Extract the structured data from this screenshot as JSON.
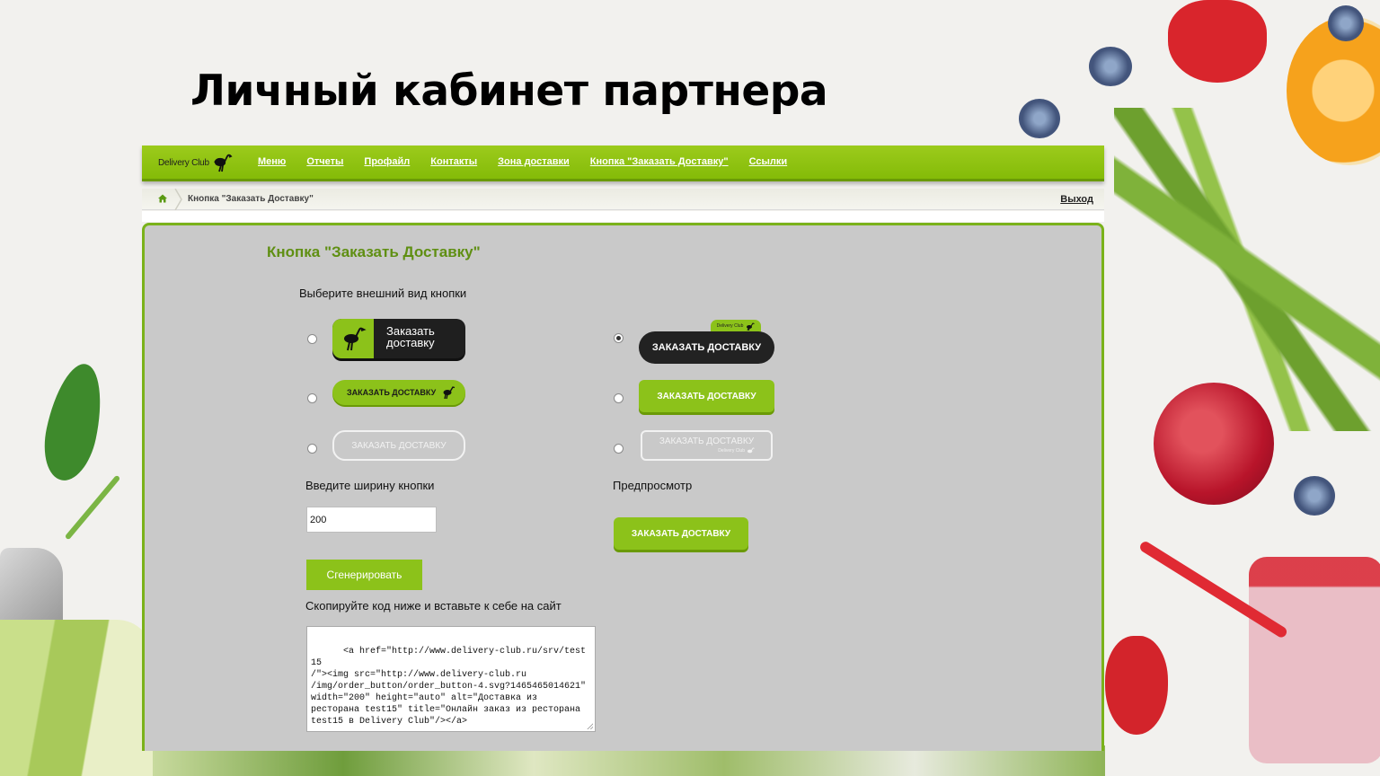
{
  "slide": {
    "title": "Личный кабинет партнера"
  },
  "topbar": {
    "logo_text": "Delivery Club",
    "nav": [
      "Меню",
      "Отчеты",
      "Профайл",
      "Контакты",
      "Зона доставки",
      "Кнопка \"Заказать Доставку\"",
      "Ссылки"
    ]
  },
  "breadcrumb": {
    "current": "Кнопка \"Заказать Доставку\"",
    "logout": "Выход"
  },
  "panel": {
    "title": "Кнопка \"Заказать Доставку\"",
    "choose_label": "Выберите внешний вид кнопки",
    "options": [
      {
        "text_line1": "Заказать",
        "text_line2": "доставку",
        "selected": false
      },
      {
        "text": "ЗАКАЗАТЬ ДОСТАВКУ",
        "selected": false
      },
      {
        "text": "ЗАКАЗАТЬ ДОСТАВКУ",
        "selected": false
      },
      {
        "badge": "Delivery Club",
        "text": "ЗАКАЗАТЬ ДОСТАВКУ",
        "selected": true
      },
      {
        "text": "ЗАКАЗАТЬ ДОСТАВКУ",
        "selected": false
      },
      {
        "text": "ЗАКАЗАТЬ ДОСТАВКУ",
        "sub": "Delivery Club",
        "selected": false
      }
    ],
    "width_label": "Введите ширину кнопки",
    "width_value": "200",
    "generate_label": "Сгенерировать",
    "preview_label": "Предпросмотр",
    "preview_button": "ЗАКАЗАТЬ ДОСТАВКУ",
    "copy_label": "Скопируйте код ниже и вставьте к себе на сайт",
    "code": "<a href=\"http://www.delivery-club.ru/srv/test15\n/\"><img src=\"http://www.delivery-club.ru\n/img/order_button/order_button-4.svg?1465465014621\"\nwidth=\"200\" height=\"auto\" alt=\"Доставка из\nресторана test15\" title=\"Онлайн заказ из ресторана\ntest15 в Delivery Club\"/></a>"
  },
  "colors": {
    "brand_green": "#8cc21a",
    "panel_bg": "#c9c9c9",
    "title_green": "#5f8f12"
  }
}
